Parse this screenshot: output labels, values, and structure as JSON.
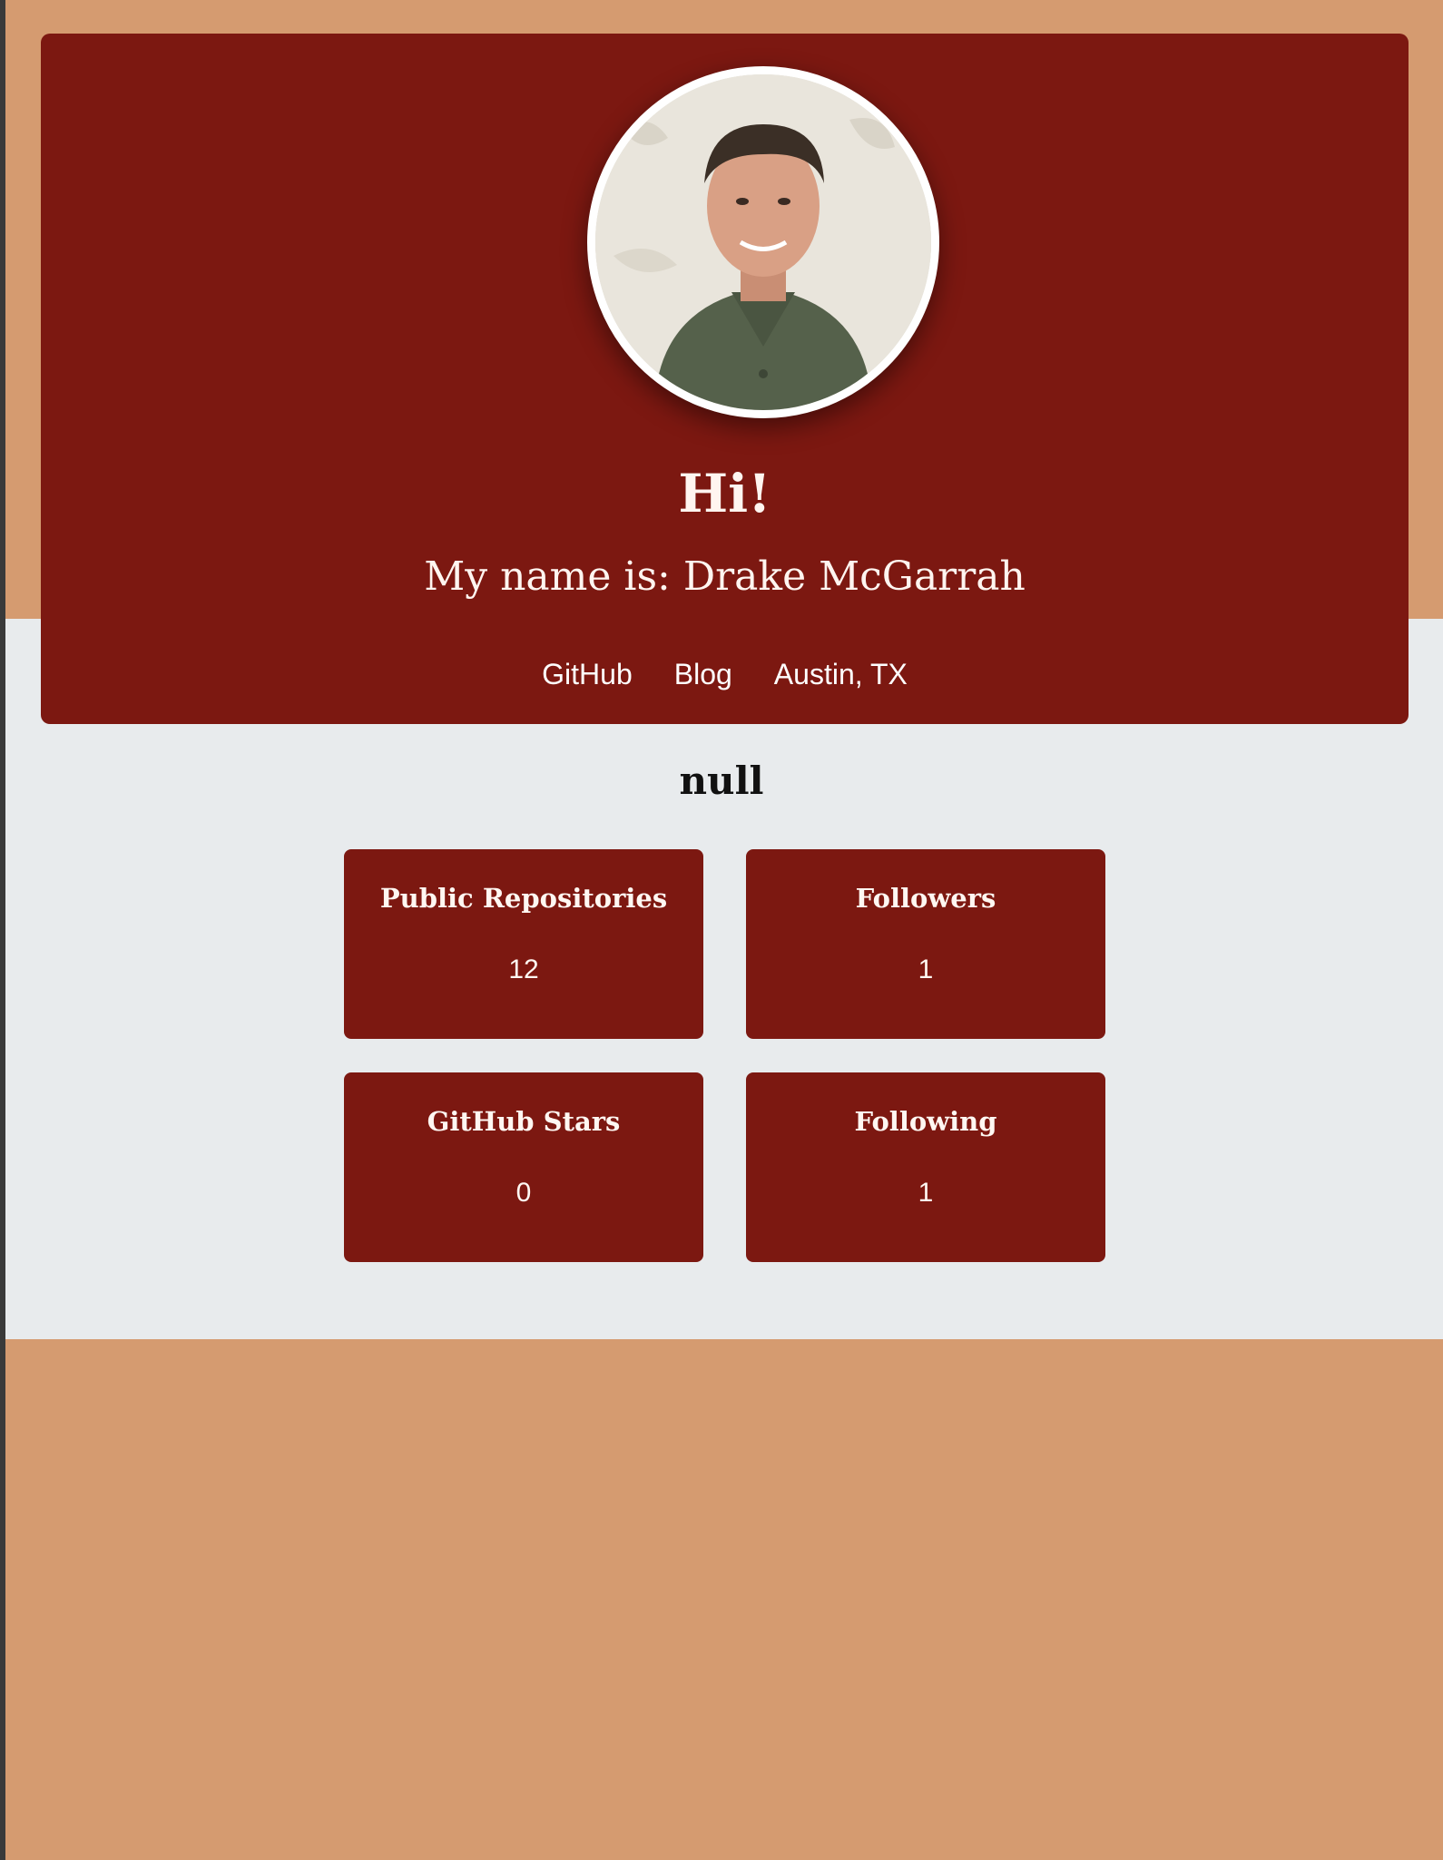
{
  "header": {
    "greeting": "Hi!",
    "name_line": "My name is: Drake McGarrah",
    "links": {
      "github": "GitHub",
      "blog": "Blog",
      "location": "Austin, TX"
    }
  },
  "bio": "null",
  "stats": [
    {
      "label": "Public Repositories",
      "value": "12"
    },
    {
      "label": "Followers",
      "value": "1"
    },
    {
      "label": "GitHub Stars",
      "value": "0"
    },
    {
      "label": "Following",
      "value": "1"
    }
  ],
  "colors": {
    "page_background": "#d59b70",
    "band_background": "#e8ebed",
    "card_background": "#7c1811",
    "text_light": "#ffffff",
    "text_dark": "#111111"
  }
}
